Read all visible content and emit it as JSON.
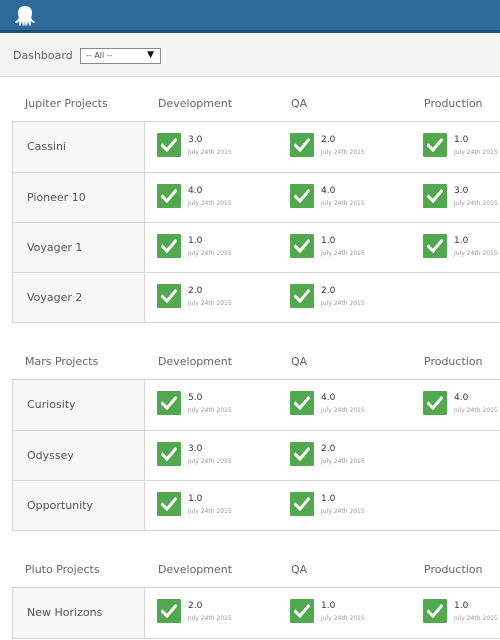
{
  "toolbar": {
    "dashboard_label": "Dashboard",
    "filter_value": "-- All --"
  },
  "columns": {
    "dev": "Development",
    "qa": "QA",
    "prod": "Production"
  },
  "colors": {
    "header": "#2d6a9a",
    "success": "#52a84f"
  },
  "sections": [
    {
      "title": "Jupiter Projects",
      "rows": [
        {
          "name": "Cassini",
          "dev": {
            "v": "3.0",
            "d": "July 24th 2015"
          },
          "qa": {
            "v": "2.0",
            "d": "July 24th 2015"
          },
          "prod": {
            "v": "1.0",
            "d": "July 24th 2015"
          }
        },
        {
          "name": "Pioneer 10",
          "dev": {
            "v": "4.0",
            "d": "July 24th 2015"
          },
          "qa": {
            "v": "4.0",
            "d": "July 24th 2015"
          },
          "prod": {
            "v": "3.0",
            "d": "July 24th 2015"
          }
        },
        {
          "name": "Voyager 1",
          "dev": {
            "v": "1.0",
            "d": "July 24th 2015"
          },
          "qa": {
            "v": "1.0",
            "d": "July 24th 2015"
          },
          "prod": {
            "v": "1.0",
            "d": "July 24th 2015"
          }
        },
        {
          "name": "Voyager 2",
          "dev": {
            "v": "2.0",
            "d": "July 24th 2015"
          },
          "qa": {
            "v": "2.0",
            "d": "July 24th 2015"
          },
          "prod": null
        }
      ]
    },
    {
      "title": "Mars Projects",
      "rows": [
        {
          "name": "Curiosity",
          "dev": {
            "v": "5.0",
            "d": "July 24th 2015"
          },
          "qa": {
            "v": "4.0",
            "d": "July 24th 2015"
          },
          "prod": {
            "v": "4.0",
            "d": "July 24th 2015"
          }
        },
        {
          "name": "Odyssey",
          "dev": {
            "v": "3.0",
            "d": "July 24th 2015"
          },
          "qa": {
            "v": "2.0",
            "d": "July 24th 2015"
          },
          "prod": null
        },
        {
          "name": "Opportunity",
          "dev": {
            "v": "1.0",
            "d": "July 24th 2015"
          },
          "qa": {
            "v": "1.0",
            "d": "July 24th 2015"
          },
          "prod": null
        }
      ]
    },
    {
      "title": "Pluto Projects",
      "rows": [
        {
          "name": "New Horizons",
          "dev": {
            "v": "2.0",
            "d": "July 24th 2015"
          },
          "qa": {
            "v": "1.0",
            "d": "July 24th 2015"
          },
          "prod": {
            "v": "1.0",
            "d": "July 24th 2015"
          }
        }
      ]
    }
  ]
}
